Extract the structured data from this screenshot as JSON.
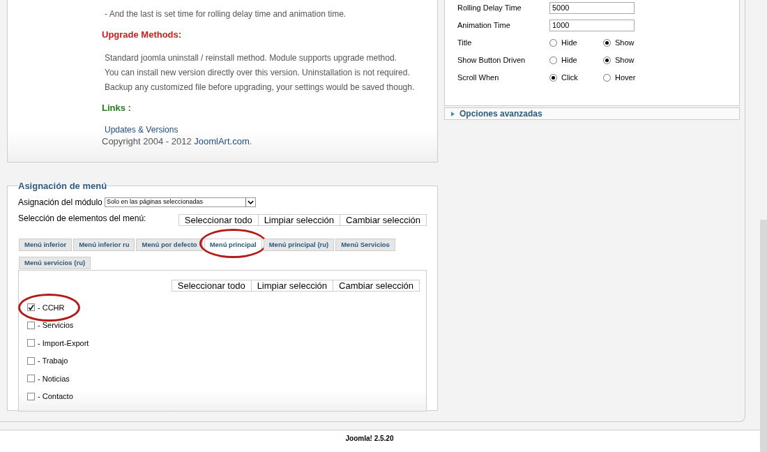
{
  "description": {
    "lines": [
      "- And the last is set time for rolling delay time and animation time."
    ],
    "upgrade_heading": "Upgrade Methods:",
    "upgrade_lines": [
      "Standard joomla uninstall / reinstall method. Module supports upgrade method.",
      "You can install new version directly over this version. Uninstallation is not required.",
      "Backup any customized file before upgrading, your settings would be saved though."
    ],
    "links_heading": "Links :",
    "links": [
      "Updates & Versions"
    ],
    "copyright": {
      "text": "Copyright 2004 - 2012 ",
      "link": "JoomlArt.com",
      "suffix": "."
    }
  },
  "params": [
    {
      "kind": "text",
      "label": "Rolling Delay Time",
      "value": "5000"
    },
    {
      "kind": "text",
      "label": "Animation Time",
      "value": "1000"
    },
    {
      "kind": "radio",
      "label": "Title",
      "options": [
        {
          "label": "Hide",
          "selected": false
        },
        {
          "label": "Show",
          "selected": true
        }
      ]
    },
    {
      "kind": "radio",
      "label": "Show Button Driven",
      "options": [
        {
          "label": "Hide",
          "selected": false
        },
        {
          "label": "Show",
          "selected": true
        }
      ]
    },
    {
      "kind": "radio",
      "label": "Scroll When",
      "options": [
        {
          "label": "Click",
          "selected": true
        },
        {
          "label": "Hover",
          "selected": false
        }
      ]
    }
  ],
  "advanced": {
    "label": "Opciones avanzadas",
    "expanded": false
  },
  "menu_assignment": {
    "legend": "Asignación de menú",
    "module_label": "Asignación del módulo",
    "module_value": "Solo en las páginas seleccionadas",
    "selection_label": "Selección de elementos del menú:",
    "buttons": [
      "Seleccionar todo",
      "Limpiar selección",
      "Cambiar selección"
    ],
    "tabs": [
      {
        "label": "Menú inferior",
        "selected": false,
        "circled": false
      },
      {
        "label": "Menú inferior ru",
        "selected": false,
        "circled": false
      },
      {
        "label": "Menú por defecto",
        "selected": false,
        "circled": false
      },
      {
        "label": "Menú principal",
        "selected": true,
        "circled": true
      },
      {
        "label": "Menú principal (ru)",
        "selected": false,
        "circled": false
      },
      {
        "label": "Menú Servicios",
        "selected": false,
        "circled": false
      },
      {
        "label": "Menú servicios (ru)",
        "selected": false,
        "circled": false
      }
    ],
    "inner_buttons": [
      "Seleccionar todo",
      "Limpiar selección",
      "Cambiar selección"
    ],
    "items": [
      {
        "label": "- CCHR",
        "checked": true,
        "circled": true
      },
      {
        "label": "- Servicios",
        "checked": false,
        "circled": false
      },
      {
        "label": "- Import-Export",
        "checked": false,
        "circled": false
      },
      {
        "label": "- Trabajo",
        "checked": false,
        "circled": false
      },
      {
        "label": "- Noticias",
        "checked": false,
        "circled": false
      },
      {
        "label": "- Contacto",
        "checked": false,
        "circled": false
      }
    ]
  },
  "footer": "Joomla! 2.5.20"
}
